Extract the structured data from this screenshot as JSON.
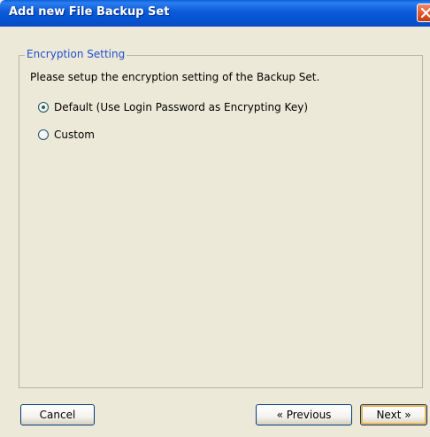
{
  "window": {
    "title": "Add new File Backup Set"
  },
  "group": {
    "legend": "Encryption Setting",
    "instruction": "Please setup the encryption setting of the Backup Set."
  },
  "options": [
    {
      "label": "Default (Use Login Password as Encrypting Key)",
      "selected": true
    },
    {
      "label": "Custom",
      "selected": false
    }
  ],
  "buttons": {
    "cancel": "Cancel",
    "previous": "« Previous",
    "next": "Next »"
  },
  "colors": {
    "titlebar": "#0554d2",
    "legend": "#1f4fd0",
    "dialog_bg": "#ece9d8",
    "close": "#e35a30",
    "default_button_glow": "#f2b34a"
  },
  "icons": {
    "close": "close-icon"
  }
}
